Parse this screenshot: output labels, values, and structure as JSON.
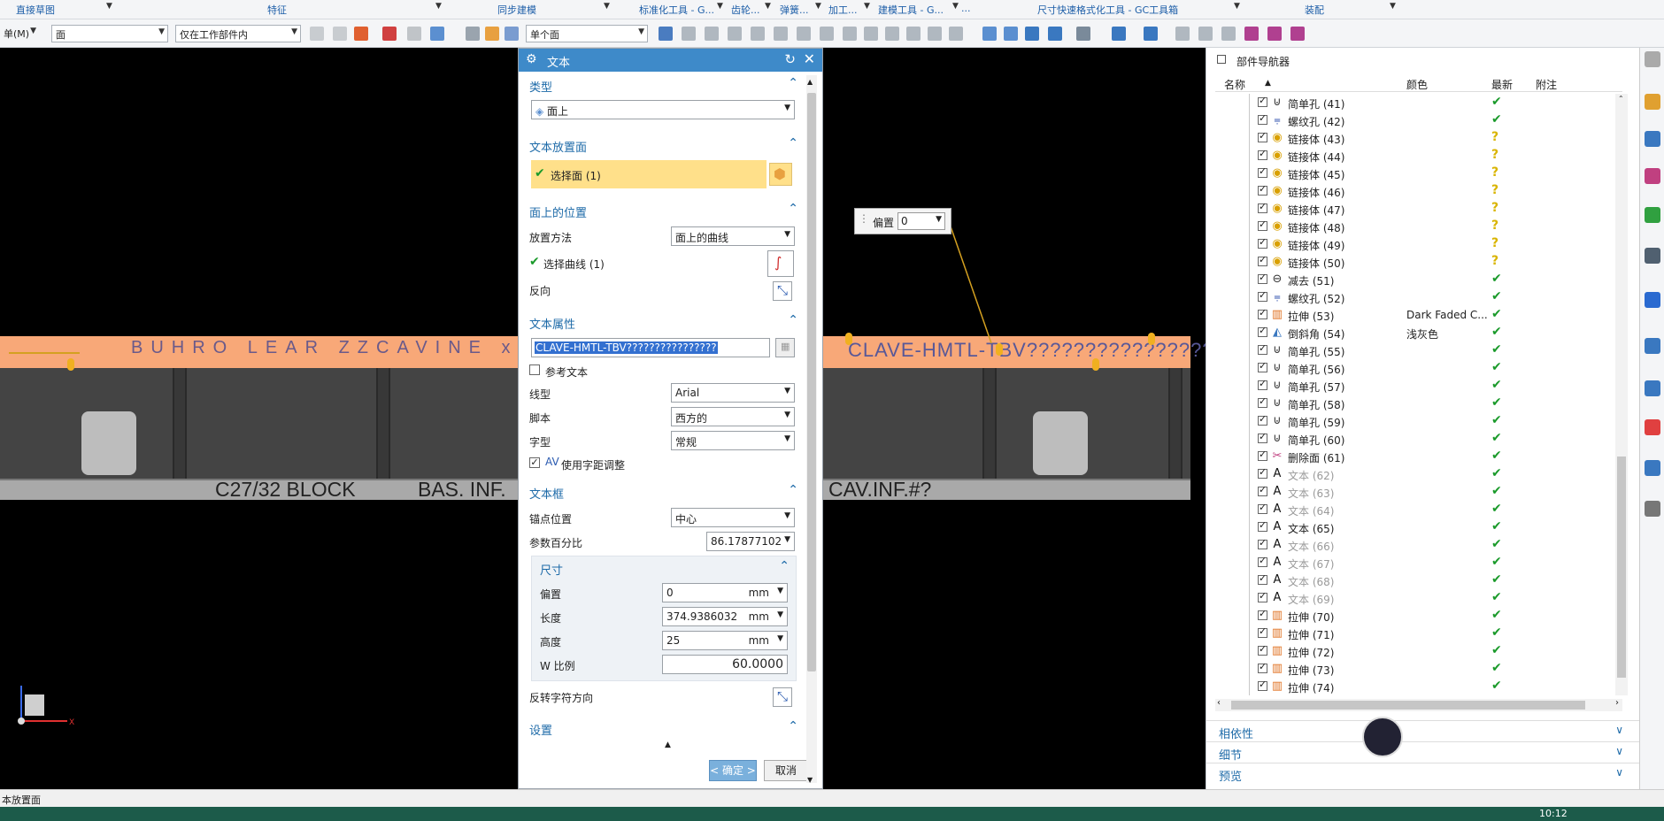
{
  "ribbon": {
    "groups": [
      "直接草图",
      "特征",
      "同步建模",
      "标准化工具 - G...",
      "齿轮...",
      "弹簧...",
      "加工...",
      "建模工具 - G...",
      "...",
      "尺寸快速格式化工具 - GC工具箱",
      "装配"
    ],
    "menu_left": "单(M)",
    "filter_face": "面",
    "filter_scope": "仅在工作部件内",
    "filter_single_face": "单个面"
  },
  "viewport": {
    "text_top_left": "BUHRO LEAR ZZCAVINE x",
    "text_top_right": "CLAVE-HMTL-TBV????????????????",
    "text_bottom_1": "C27/32 BLOCK",
    "text_bottom_2": "BAS. INF.",
    "text_bottom_3": "CAV.INF.#?",
    "offset_label": "偏置",
    "offset_value": "0"
  },
  "dialog": {
    "title": "文本",
    "sec_type": "类型",
    "type_value": "面上",
    "sec_placement_face": "文本放置面",
    "select_face": "选择面 (1)",
    "sec_position": "面上的位置",
    "place_method_label": "放置方法",
    "place_method_value": "面上的曲线",
    "select_curve": "选择曲线 (1)",
    "reverse_label": "反向",
    "sec_attrs": "文本属性",
    "text_value": "CLAVE-HMTL-TBV????????????????",
    "ref_text": "参考文本",
    "line_type_label": "线型",
    "line_type_value": "Arial",
    "script_label": "脚本",
    "script_value": "西方的",
    "font_style_label": "字型",
    "font_style_value": "常规",
    "kerning": "使用字距调整",
    "sec_frame": "文本框",
    "anchor_label": "锚点位置",
    "anchor_value": "中心",
    "param_pct_label": "参数百分比",
    "param_pct_value": "86.17877102",
    "sub_size": "尺寸",
    "offset_label": "偏置",
    "offset_value": "0",
    "length_label": "长度",
    "length_value": "374.9386032",
    "height_label": "高度",
    "height_value": "25",
    "unit": "mm",
    "w_ratio_label": "W 比例",
    "w_ratio_value": "60.0000",
    "flip_label": "反转字符方向",
    "sec_settings": "设置",
    "ok": "< 确定 >",
    "cancel": "取消"
  },
  "navigator": {
    "title": "部件导航器",
    "col_name": "名称",
    "col_color": "颜色",
    "col_latest": "最新",
    "col_note": "附注",
    "rows": [
      {
        "name": "简单孔 (41)",
        "icon": "hole",
        "color": "",
        "status": "ok",
        "dim": false
      },
      {
        "name": "螺纹孔 (42)",
        "icon": "thread",
        "color": "",
        "status": "ok",
        "dim": false
      },
      {
        "name": "链接体 (43)",
        "icon": "link",
        "color": "",
        "status": "q",
        "dim": false
      },
      {
        "name": "链接体 (44)",
        "icon": "link",
        "color": "",
        "status": "q",
        "dim": false
      },
      {
        "name": "链接体 (45)",
        "icon": "link",
        "color": "",
        "status": "q",
        "dim": false
      },
      {
        "name": "链接体 (46)",
        "icon": "link",
        "color": "",
        "status": "q",
        "dim": false
      },
      {
        "name": "链接体 (47)",
        "icon": "link",
        "color": "",
        "status": "q",
        "dim": false
      },
      {
        "name": "链接体 (48)",
        "icon": "link",
        "color": "",
        "status": "q",
        "dim": false
      },
      {
        "name": "链接体 (49)",
        "icon": "link",
        "color": "",
        "status": "q",
        "dim": false
      },
      {
        "name": "链接体 (50)",
        "icon": "link",
        "color": "",
        "status": "q",
        "dim": false
      },
      {
        "name": "减去 (51)",
        "icon": "subtract",
        "color": "",
        "status": "ok",
        "dim": false
      },
      {
        "name": "螺纹孔 (52)",
        "icon": "thread",
        "color": "",
        "status": "ok",
        "dim": false
      },
      {
        "name": "拉伸 (53)",
        "icon": "extrude",
        "color": "Dark Faded C...",
        "status": "ok",
        "dim": false
      },
      {
        "name": "倒斜角 (54)",
        "icon": "chamfer",
        "color": "浅灰色",
        "status": "ok",
        "dim": false
      },
      {
        "name": "简单孔 (55)",
        "icon": "hole",
        "color": "",
        "status": "ok",
        "dim": false
      },
      {
        "name": "简单孔 (56)",
        "icon": "hole",
        "color": "",
        "status": "ok",
        "dim": false
      },
      {
        "name": "简单孔 (57)",
        "icon": "hole",
        "color": "",
        "status": "ok",
        "dim": false
      },
      {
        "name": "简单孔 (58)",
        "icon": "hole",
        "color": "",
        "status": "ok",
        "dim": false
      },
      {
        "name": "简单孔 (59)",
        "icon": "hole",
        "color": "",
        "status": "ok",
        "dim": false
      },
      {
        "name": "简单孔 (60)",
        "icon": "hole",
        "color": "",
        "status": "ok",
        "dim": false
      },
      {
        "name": "删除面 (61)",
        "icon": "delete",
        "color": "",
        "status": "ok",
        "dim": false
      },
      {
        "name": "文本 (62)",
        "icon": "text",
        "color": "",
        "status": "ok",
        "dim": true
      },
      {
        "name": "文本 (63)",
        "icon": "text",
        "color": "",
        "status": "ok",
        "dim": true
      },
      {
        "name": "文本 (64)",
        "icon": "text",
        "color": "",
        "status": "ok",
        "dim": true
      },
      {
        "name": "文本 (65)",
        "icon": "text",
        "color": "",
        "status": "ok",
        "dim": false
      },
      {
        "name": "文本 (66)",
        "icon": "text",
        "color": "",
        "status": "ok",
        "dim": true
      },
      {
        "name": "文本 (67)",
        "icon": "text",
        "color": "",
        "status": "ok",
        "dim": true
      },
      {
        "name": "文本 (68)",
        "icon": "text",
        "color": "",
        "status": "ok",
        "dim": true
      },
      {
        "name": "文本 (69)",
        "icon": "text",
        "color": "",
        "status": "ok",
        "dim": true
      },
      {
        "name": "拉伸 (70)",
        "icon": "extrude",
        "color": "",
        "status": "ok",
        "dim": false
      },
      {
        "name": "拉伸 (71)",
        "icon": "extrude",
        "color": "",
        "status": "ok",
        "dim": false
      },
      {
        "name": "拉伸 (72)",
        "icon": "extrude",
        "color": "",
        "status": "ok",
        "dim": false
      },
      {
        "name": "拉伸 (73)",
        "icon": "extrude",
        "color": "",
        "status": "ok",
        "dim": false
      },
      {
        "name": "拉伸 (74)",
        "icon": "extrude",
        "color": "",
        "status": "ok",
        "dim": false
      }
    ],
    "footer_dependency": "相依性",
    "footer_details": "细节",
    "footer_preview": "预览"
  },
  "status": {
    "text": "本放置面",
    "time": "10:12"
  },
  "colors": {
    "accent": "#3e8ac9",
    "beam_orange": "#f8a878",
    "highlight_yellow": "#ffe08a",
    "ok_green": "#1a9a2a",
    "question_yellow": "#d9b400",
    "red_box": "#e6252b"
  }
}
